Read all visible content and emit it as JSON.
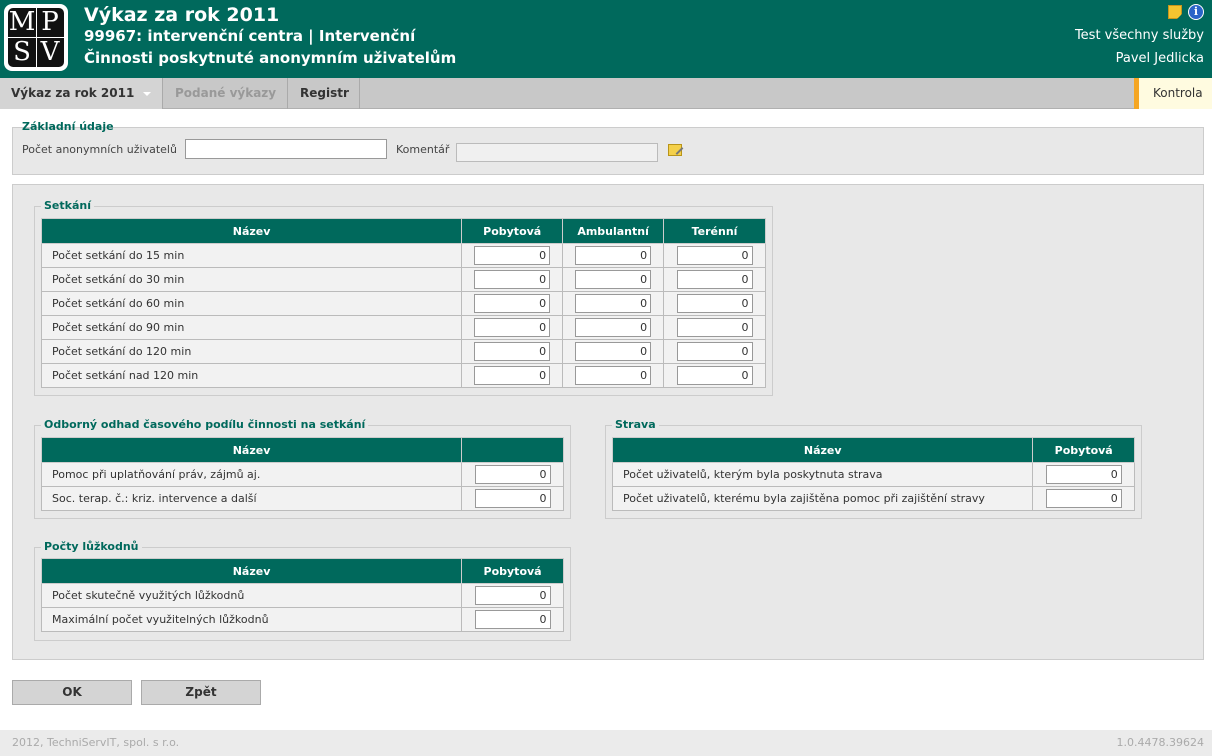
{
  "header": {
    "logo": {
      "top_left": "M",
      "top_right": "P",
      "bottom_left": "S",
      "bottom_right": "V"
    },
    "title": "Výkaz za rok 2011",
    "subtitle": "99967: intervenční centra | Intervenční",
    "subtitle2": "Činnosti poskytnuté anonymním uživatelům",
    "service": "Test všechny služby",
    "user": "Pavel Jedlicka",
    "icons": [
      "note-icon",
      "info-icon"
    ],
    "info_glyph": "i"
  },
  "nav": {
    "items": [
      {
        "label": "Výkaz za rok 2011",
        "state": "active"
      },
      {
        "label": "Podané výkazy",
        "state": "disabled"
      },
      {
        "label": "Registr",
        "state": "normal"
      }
    ],
    "kontrola": "Kontrola"
  },
  "zakladni": {
    "legend": "Základní údaje",
    "anon_label": "Počet anonymních uživatelů",
    "anon_value": "",
    "comment_label": "Komentář",
    "comment_value": ""
  },
  "setkani": {
    "legend": "Setkání",
    "columns": [
      "Název",
      "Pobytová",
      "Ambulantní",
      "Terénní"
    ],
    "rows": [
      {
        "label": "Počet setkání do 15 min",
        "values": [
          "0",
          "0",
          "0"
        ]
      },
      {
        "label": "Počet setkání do 30 min",
        "values": [
          "0",
          "0",
          "0"
        ]
      },
      {
        "label": "Počet setkání do 60 min",
        "values": [
          "0",
          "0",
          "0"
        ]
      },
      {
        "label": "Počet setkání do 90 min",
        "values": [
          "0",
          "0",
          "0"
        ]
      },
      {
        "label": "Počet setkání do 120 min",
        "values": [
          "0",
          "0",
          "0"
        ]
      },
      {
        "label": "Počet setkání nad 120 min",
        "values": [
          "0",
          "0",
          "0"
        ]
      }
    ]
  },
  "odhad": {
    "legend": "Odborný odhad časového podílu činnosti na setkání",
    "columns": [
      "Název",
      ""
    ],
    "rows": [
      {
        "label": "Pomoc při uplatňování práv, zájmů aj.",
        "value": "0"
      },
      {
        "label": "Soc. terap. č.: kriz. intervence a další",
        "value": "0"
      }
    ]
  },
  "strava": {
    "legend": "Strava",
    "columns": [
      "Název",
      "Pobytová"
    ],
    "rows": [
      {
        "label": "Počet uživatelů, kterým byla poskytnuta strava",
        "value": "0"
      },
      {
        "label": "Počet uživatelů, kterému byla zajištěna pomoc při zajištění stravy",
        "value": "0"
      }
    ]
  },
  "luzka": {
    "legend": "Počty lůžkodnů",
    "columns": [
      "Název",
      "Pobytová"
    ],
    "rows": [
      {
        "label": "Počet skutečně využitých lůžkodnů",
        "value": "0"
      },
      {
        "label": "Maximální počet využitelných lůžkodnů",
        "value": "0"
      }
    ]
  },
  "buttons": {
    "ok": "OK",
    "back": "Zpět"
  },
  "footer": {
    "copyright": "2012, TechniServIT, spol. s r.o.",
    "version": "1.0.4478.39624"
  },
  "colors": {
    "brand": "#00695c",
    "accent": "#f5a623"
  }
}
